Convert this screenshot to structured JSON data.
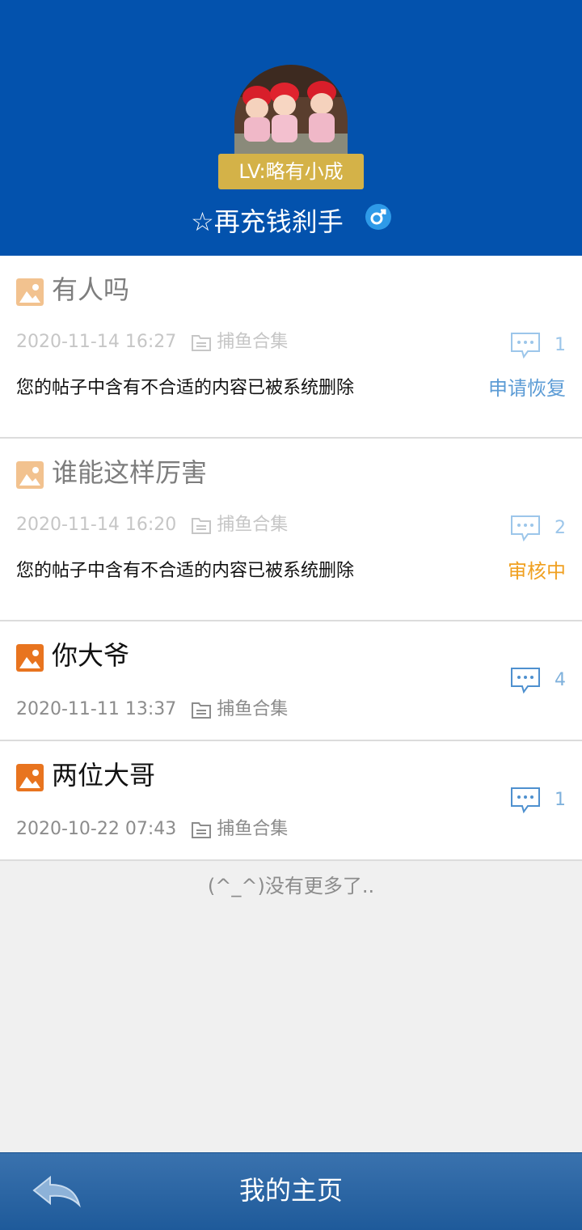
{
  "profile": {
    "level_badge": "LV:略有小成",
    "username": "☆再充钱刹手",
    "gender_icon": "male-icon"
  },
  "posts": [
    {
      "title": "有人吗",
      "time": "2020-11-14 16:27",
      "category": "捕鱼合集",
      "comments": "1",
      "notice": "您的帖子中含有不合适的内容已被系统删除",
      "action": "申请恢复",
      "action_color": "#5b9bd5"
    },
    {
      "title": "谁能这样厉害",
      "time": "2020-11-14 16:20",
      "category": "捕鱼合集",
      "comments": "2",
      "notice": "您的帖子中含有不合适的内容已被系统删除",
      "action": "审核中",
      "action_color": "#f0a020"
    },
    {
      "title": "你大爷",
      "time": "2020-11-11 13:37",
      "category": "捕鱼合集",
      "comments": "4"
    },
    {
      "title": "两位大哥",
      "time": "2020-10-22 07:43",
      "category": "捕鱼合集",
      "comments": "1"
    }
  ],
  "list_end_text": "(^_^)没有更多了..",
  "bottom_bar": {
    "title": "我的主页",
    "back_icon": "back-arrow-icon"
  },
  "colors": {
    "header_bg": "#0352ad",
    "badge_bg": "#d4b248",
    "image_icon_faded": "#f2c28f",
    "image_icon_active": "#e8741f"
  }
}
